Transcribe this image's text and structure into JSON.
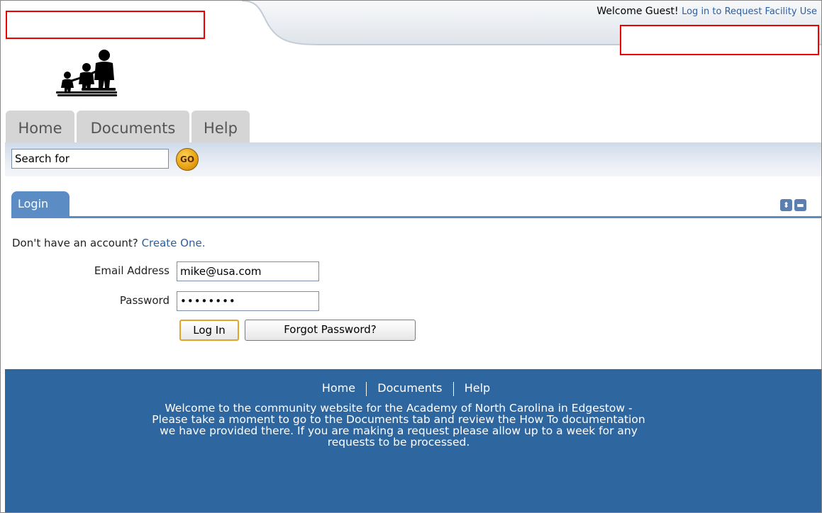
{
  "header": {
    "welcome": "Welcome Guest!",
    "login_link": "Log in to Request Facility Use"
  },
  "tabs": [
    {
      "label": "Home"
    },
    {
      "label": "Documents"
    },
    {
      "label": "Help"
    }
  ],
  "search": {
    "value": "Search for",
    "go_label": "GO"
  },
  "login": {
    "tab_label": "Login",
    "account_prompt": "Don't have an account?",
    "create_link": "Create One.",
    "email_label": "Email Address",
    "email_value": "mike@usa.com",
    "password_label": "Password",
    "password_value": "••••••••",
    "login_button": "Log In",
    "forgot_button": "Forgot Password?"
  },
  "footer": {
    "links": [
      "Home",
      "Documents",
      "Help"
    ],
    "text": "Welcome to the community website for the Academy of North Carolina in Edgestow - Please take a moment to go to the Documents tab and review the How To documentation we have provided there. If you are making a request please allow up to a week for any requests to be processed."
  },
  "colors": {
    "accent": "#5b8cc4",
    "footer_bg": "#2e66a0",
    "link": "#2a5fa3",
    "redaction": "#ee0000"
  }
}
